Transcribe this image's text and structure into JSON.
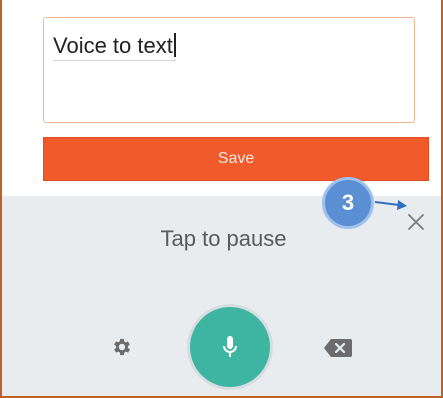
{
  "editor": {
    "text": "Voice to text"
  },
  "actions": {
    "save_label": "Save"
  },
  "voice_panel": {
    "status": "Tap to pause",
    "close_icon": "close-icon",
    "settings_icon": "gear-icon",
    "mic_icon": "microphone-icon",
    "backspace_icon": "backspace-icon"
  },
  "annotation": {
    "step_number": "3"
  },
  "colors": {
    "accent": "#f15a2b",
    "mic": "#3db5a0",
    "panel": "#e8ecef",
    "badge": "#5b8fd4"
  }
}
